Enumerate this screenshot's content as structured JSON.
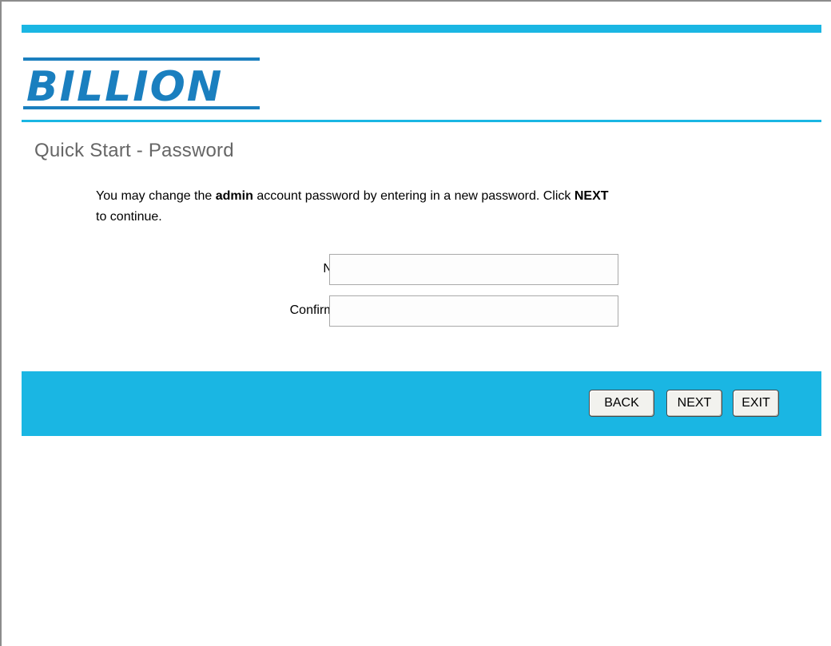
{
  "brand": {
    "logo_text": "BILLION",
    "accent_color": "#1ab6e3",
    "logo_color": "#1a7fbf"
  },
  "page": {
    "title": "Quick Start - Password"
  },
  "intro": {
    "part1": "You may change the ",
    "bold1": "admin",
    "part2": " account password by entering in a new password. Click ",
    "bold2": "NEXT",
    "part3": " to continue."
  },
  "form": {
    "new_password": {
      "label": "New Password :",
      "value": ""
    },
    "confirmed_password": {
      "label": "Confirmed Password :",
      "value": ""
    }
  },
  "buttons": {
    "back": "BACK",
    "next": "NEXT",
    "exit": "EXIT"
  }
}
